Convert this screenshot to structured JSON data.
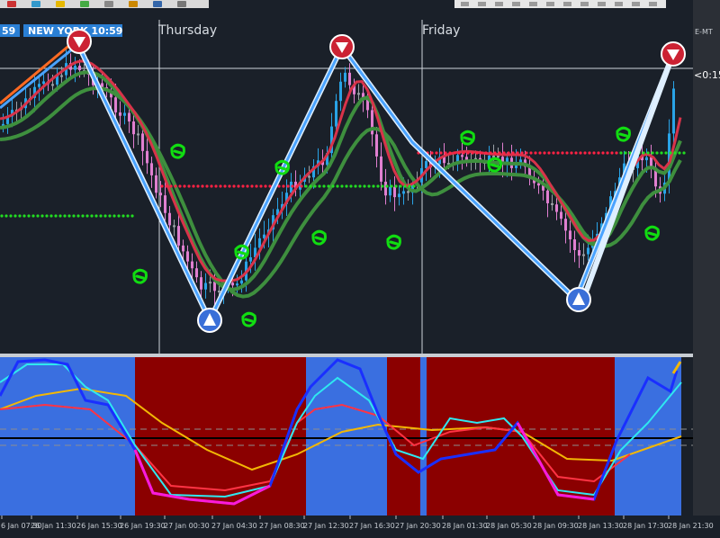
{
  "session_boxes": [
    {
      "text": "59"
    },
    {
      "text": "NEW YORK  10:59"
    }
  ],
  "day_labels": [
    "Thursday",
    "Friday"
  ],
  "right_panel": {
    "logo_text": "E-MT",
    "timer_text": "<0:15"
  },
  "time_axis": {
    "ticks": [
      "6 Jan 07:30",
      "26 Jan 11:30",
      "26 Jan 15:30",
      "26 Jan 19:30",
      "27 Jan 00:30",
      "27 Jan 04:30",
      "27 Jan 08:30",
      "27 Jan 12:30",
      "27 Jan 16:30",
      "27 Jan 20:30",
      "28 Jan 01:30",
      "28 Jan 05:30",
      "28 Jan 09:30",
      "28 Jan 13:30",
      "28 Jan 17:30",
      "28 Jan 21:30"
    ]
  },
  "colors": {
    "background": "#1a2029",
    "bull_candle": "#29a3e6",
    "bear_candle": "#e07fd0",
    "neutral_candle": "#9aa0a6",
    "fast_ma": "#d8334a",
    "slow_ma": "#3e8f3e",
    "zigzag": "#4aa3ff",
    "signal_green": "#11dd11",
    "osc_blue": "#3a6fe0",
    "osc_red": "#8b0000",
    "osc_line_blue": "#1a2fff",
    "osc_line_cyan": "#2fe8f0",
    "osc_line_magenta": "#ff1ad8",
    "osc_line_orange": "#f2b705"
  },
  "chart_data": {
    "type": "candlestick",
    "panels": [
      "price",
      "oscillator"
    ],
    "markers": [
      {
        "kind": "sell-arrow-icon",
        "x_label": "26 Jan 11:30"
      },
      {
        "kind": "buy-arrow-icon",
        "x_label": "27 Jan 00:30"
      },
      {
        "kind": "sell-arrow-icon",
        "x_label": "27 Jan 12:30"
      },
      {
        "kind": "buy-arrow-icon",
        "x_label": "28 Jan 09:30"
      },
      {
        "kind": "sell-arrow-icon",
        "x_label": "28 Jan 21:30"
      }
    ],
    "oscillator_zones": [
      "bullish",
      "bearish",
      "bullish",
      "bearish",
      "bullish",
      "bearish",
      "bullish"
    ]
  }
}
